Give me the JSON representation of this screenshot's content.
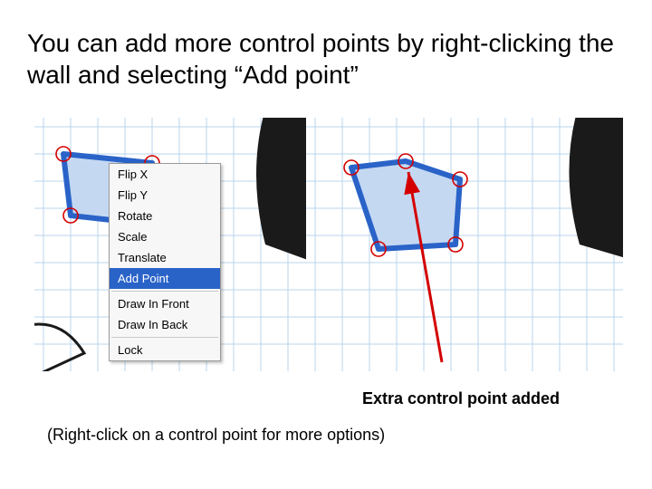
{
  "heading": "You can add more control points by right-clicking the wall and selecting “Add point”",
  "menu": {
    "items": [
      "Flip X",
      "Flip Y",
      "Rotate",
      "Scale",
      "Translate",
      "Add Point",
      "Draw In Front",
      "Draw In Back",
      "Lock"
    ],
    "selected_index": 5
  },
  "caption_b": "Extra control point added",
  "footnote": "(Right-click on a control point for more options)",
  "colors": {
    "wall": "#2a63c8",
    "grid": "#b9d4ec",
    "ring": "#d40000",
    "arrow": "#d40000"
  }
}
